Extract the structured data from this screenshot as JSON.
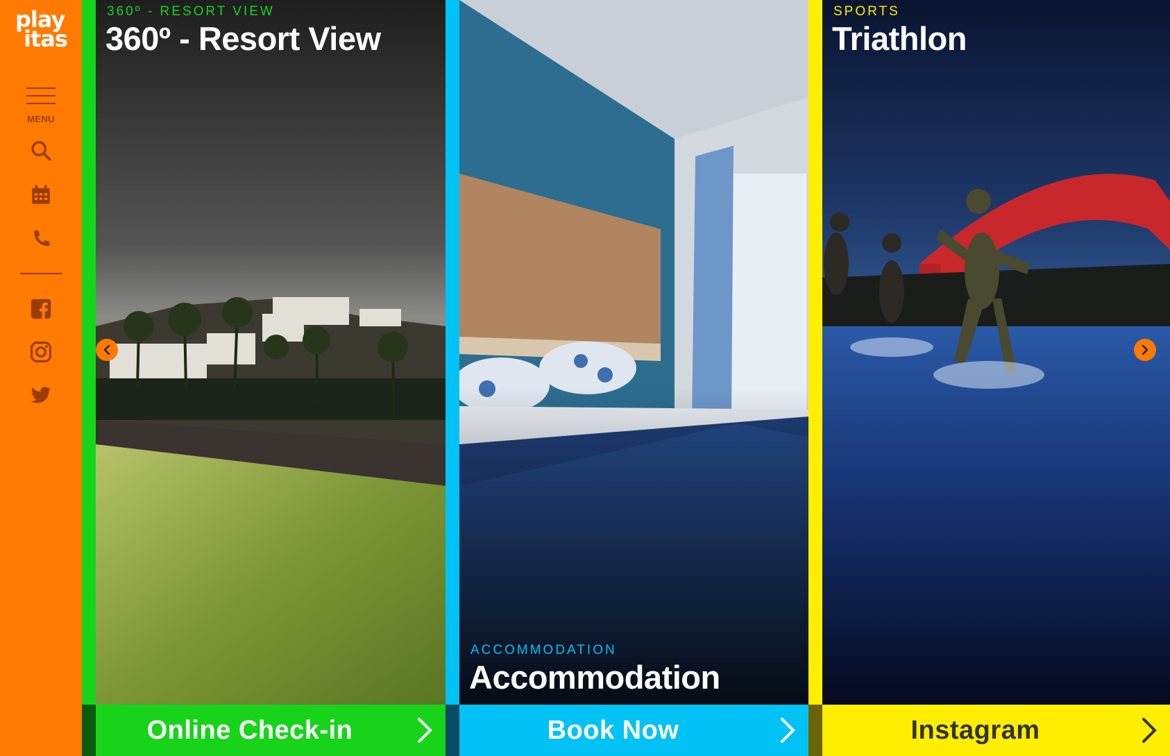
{
  "brand": {
    "logo_line1": "play",
    "logo_line2": "itas"
  },
  "sidebar": {
    "menu_label": "MENU",
    "icons": [
      "search-icon",
      "calendar-icon",
      "phone-icon",
      "facebook-icon",
      "instagram-icon",
      "twitter-icon"
    ]
  },
  "panels": [
    {
      "category": "360º - RESORT VIEW",
      "title": "360º - Resort View",
      "button_label": "Online Check-in",
      "accent": "#17d41b"
    },
    {
      "category": "ACCOMMODATION",
      "title": "Accommodation",
      "button_label": "Book Now",
      "accent": "#00c2f5"
    },
    {
      "category": "SPORTS",
      "title": "Triathlon",
      "button_label": "Instagram",
      "accent": "#ffee00"
    }
  ],
  "colors": {
    "sidebar": "#ff7a00",
    "arrow": "#ff7a00"
  }
}
